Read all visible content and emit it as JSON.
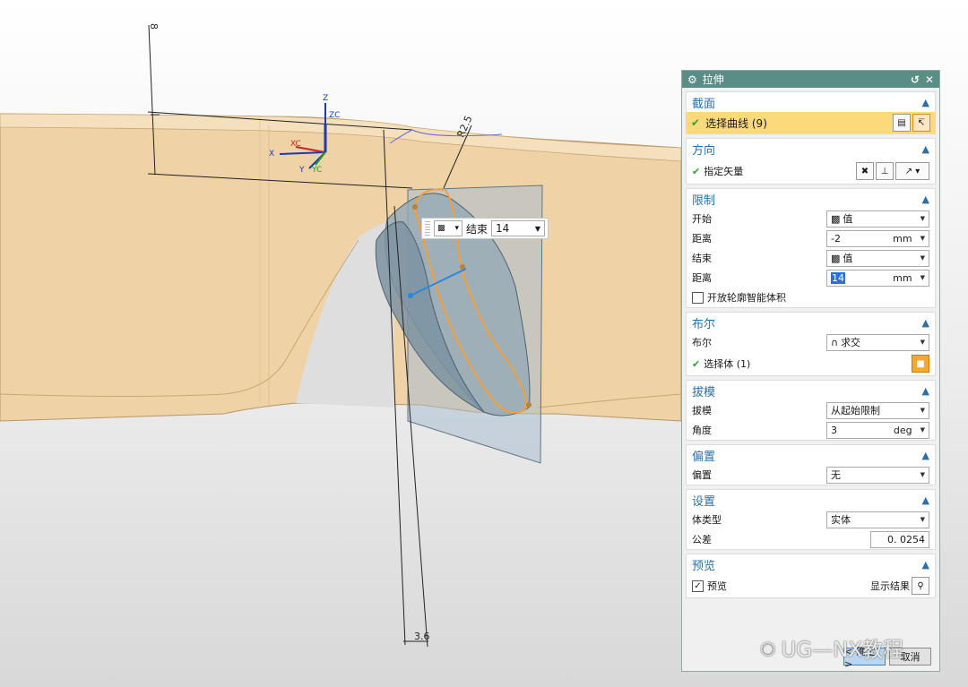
{
  "viewport": {
    "dim_top": "8",
    "dim_radius": "R2.5",
    "dim_bottom": "3.6",
    "axis_z": "Z",
    "axis_zc": "ZC",
    "axis_x": "X",
    "axis_xc": "XC",
    "axis_y": "Y",
    "axis_yc": "YC"
  },
  "float_toolbar": {
    "label": "结束",
    "value": "14"
  },
  "dialog": {
    "title": "拉伸",
    "section_section": {
      "header": "截面",
      "select_curve": "选择曲线 (9)"
    },
    "section_direction": {
      "header": "方向",
      "specify_vector": "指定矢量"
    },
    "section_limits": {
      "header": "限制",
      "start_label": "开始",
      "start_value": "值",
      "dist1_label": "距离",
      "dist1_value": "-2",
      "dist1_unit": "mm",
      "end_label": "结束",
      "end_value": "值",
      "dist2_label": "距离",
      "dist2_value": "14",
      "dist2_unit": "mm",
      "open_profile": "开放轮廓智能体积"
    },
    "section_boolean": {
      "header": "布尔",
      "bool_label": "布尔",
      "bool_value": "求交",
      "select_body": "选择体 (1)"
    },
    "section_draft": {
      "header": "拔模",
      "draft_label": "拔模",
      "draft_value": "从起始限制",
      "angle_label": "角度",
      "angle_value": "3",
      "angle_unit": "deg"
    },
    "section_offset": {
      "header": "偏置",
      "offset_label": "偏置",
      "offset_value": "无"
    },
    "section_settings": {
      "header": "设置",
      "body_type_label": "体类型",
      "body_type_value": "实体",
      "tolerance_label": "公差",
      "tolerance_value": "0. 0254"
    },
    "section_preview": {
      "header": "预览",
      "preview_label": "预览",
      "show_result": "显示结果"
    },
    "ok": "< 确定 >",
    "cancel": "取消"
  },
  "watermark": "UG—NX教程",
  "colors": {
    "title_bar": "#5a8e84",
    "section_header": "#2a6fa8",
    "highlight_row": "#fcd97a",
    "model_tan": "#efd3a6",
    "sketch_orange": "#f0a040"
  }
}
